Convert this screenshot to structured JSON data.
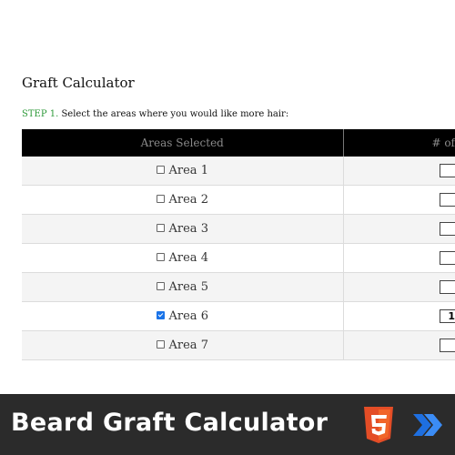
{
  "page": {
    "title": "Graft Calculator",
    "step_label": "STEP 1.",
    "step_text": " Select the areas where you would like more hair:"
  },
  "table": {
    "headers": [
      "Areas Selected",
      "# of"
    ],
    "rows": [
      {
        "label": "Area 1",
        "checked": false,
        "count": ""
      },
      {
        "label": "Area 2",
        "checked": false,
        "count": ""
      },
      {
        "label": "Area 3",
        "checked": false,
        "count": ""
      },
      {
        "label": "Area 4",
        "checked": false,
        "count": ""
      },
      {
        "label": "Area 5",
        "checked": false,
        "count": ""
      },
      {
        "label": "Area 6",
        "checked": true,
        "count": "1"
      },
      {
        "label": "Area 7",
        "checked": false,
        "count": ""
      }
    ]
  },
  "banner": {
    "title": "Beard Graft Calculator",
    "html5_icon": "html5-logo-icon",
    "brand_icon": "brand-chevron-logo-icon",
    "colors": {
      "background": "#2b2b2b",
      "html5_orange": "#e44d26",
      "brand_blue": "#1e6fe0"
    }
  }
}
